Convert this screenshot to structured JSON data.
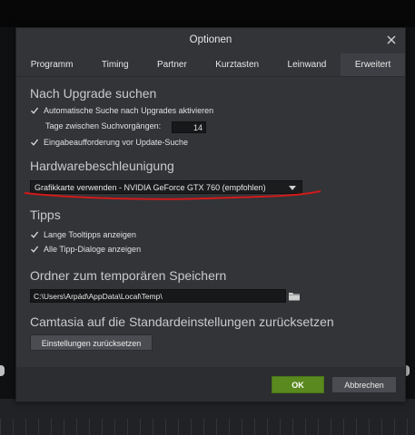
{
  "dialog": {
    "title": "Optionen"
  },
  "tabs": [
    "Programm",
    "Timing",
    "Partner",
    "Kurztasten",
    "Leinwand",
    "Erweitert"
  ],
  "active_tab": "Erweitert",
  "upgrade": {
    "heading": "Nach Upgrade suchen",
    "auto_search_label": "Automatische Suche nach Upgrades aktivieren",
    "auto_search_checked": true,
    "interval_label": "Tage zwischen Suchvorgängen:",
    "interval_value": "14",
    "prompt_label": "Eingabeaufforderung vor Update-Suche",
    "prompt_checked": true
  },
  "hardware": {
    "heading": "Hardwarebeschleunigung",
    "selected": "Grafikkarte verwenden - NVIDIA GeForce GTX 760 (empfohlen)",
    "annotation_color": "#d11a1a"
  },
  "tips": {
    "heading": "Tipps",
    "long_tooltips_label": "Lange Tooltipps anzeigen",
    "long_tooltips_checked": true,
    "all_dialogs_label": "Alle Tipp-Dialoge anzeigen",
    "all_dialogs_checked": true
  },
  "temp": {
    "heading": "Ordner zum temporären Speichern",
    "path": "C:\\Users\\Arpád\\AppData\\Local\\Temp\\"
  },
  "reset": {
    "heading": "Camtasia auf die Standardeinstellungen zurücksetzen",
    "button_label": "Einstellungen zurücksetzen"
  },
  "footer": {
    "ok_label": "OK",
    "cancel_label": "Abbrechen"
  },
  "colors": {
    "dialog_bg": "#323438",
    "ok_green": "#5a8a1f",
    "input_bg": "#17181a"
  },
  "icons": {
    "close": "close-icon",
    "check": "checkmark-icon",
    "dropdown": "chevron-down-icon",
    "folder": "folder-icon"
  }
}
